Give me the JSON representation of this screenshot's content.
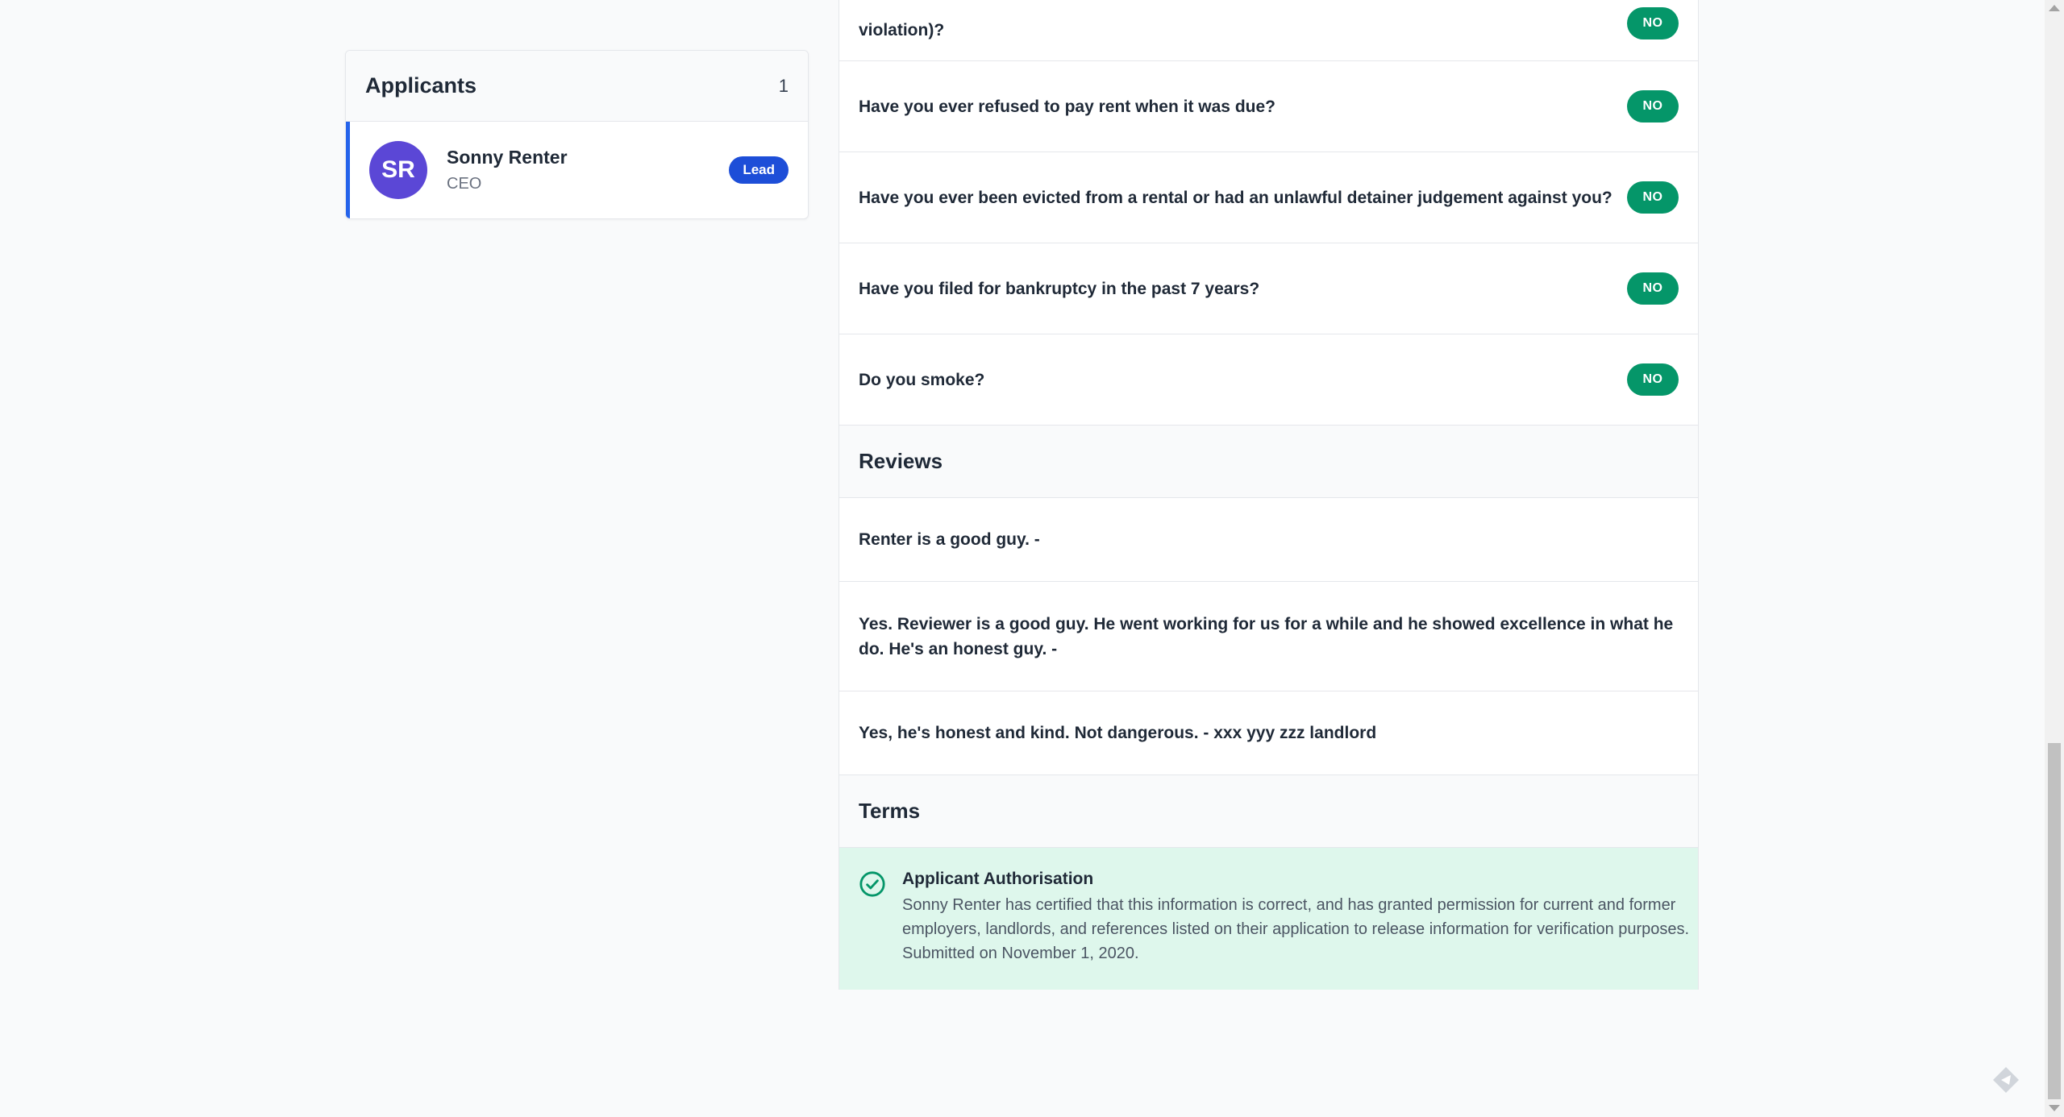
{
  "applicants": {
    "title": "Applicants",
    "count": "1",
    "list": [
      {
        "initials": "SR",
        "name": "Sonny Renter",
        "role": "CEO",
        "badge": "Lead",
        "avatar_color": "#5b47d6"
      }
    ]
  },
  "questions": [
    {
      "text": "violation)?",
      "answer": "NO"
    },
    {
      "text": "Have you ever refused to pay rent when it was due?",
      "answer": "NO"
    },
    {
      "text": "Have you ever been evicted from a rental or had an unlawful detainer judgement against you?",
      "answer": "NO"
    },
    {
      "text": "Have you filed for bankruptcy in the past 7 years?",
      "answer": "NO"
    },
    {
      "text": "Do you smoke?",
      "answer": "NO"
    }
  ],
  "reviews": {
    "title": "Reviews",
    "items": [
      "Renter is a good guy. -",
      "Yes. Reviewer is a good guy. He went working for us for a while and he showed excellence in what he do. He's an honest guy. -",
      "Yes, he's honest and kind. Not dangerous. - xxx yyy zzz landlord"
    ]
  },
  "terms": {
    "title": "Terms",
    "auth_title": "Applicant Authorisation",
    "auth_body": "Sonny Renter has certified that this information is correct, and has granted permission for current and former employers, landlords, and references listed on their application to release information for verification purposes. Submitted on November 1, 2020."
  },
  "colors": {
    "accent": "#1d4ed8",
    "success": "#059669",
    "success_bg": "#def7ec"
  }
}
